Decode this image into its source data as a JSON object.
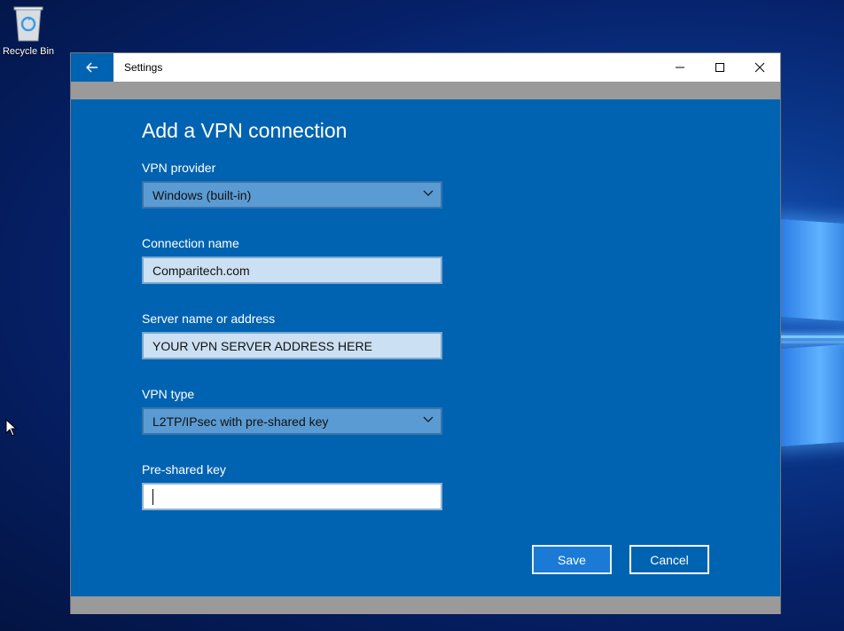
{
  "desktop": {
    "recycle_bin_label": "Recycle Bin"
  },
  "window": {
    "title": "Settings",
    "icons": {
      "back": "back-arrow-icon",
      "minimize": "minimize-icon",
      "maximize": "maximize-icon",
      "close": "close-icon"
    }
  },
  "form": {
    "title": "Add a VPN connection",
    "vpn_provider": {
      "label": "VPN provider",
      "value": "Windows (built-in)"
    },
    "connection_name": {
      "label": "Connection name",
      "value": "Comparitech.com"
    },
    "server": {
      "label": "Server name or address",
      "value": "YOUR VPN SERVER ADDRESS HERE"
    },
    "vpn_type": {
      "label": "VPN type",
      "value": "L2TP/IPsec with pre-shared key"
    },
    "psk": {
      "label": "Pre-shared key",
      "value": ""
    }
  },
  "buttons": {
    "save": "Save",
    "cancel": "Cancel"
  },
  "colors": {
    "accent": "#0063b1",
    "titlebar": "#ffffff",
    "chrome_grey": "#9a9a9a"
  }
}
